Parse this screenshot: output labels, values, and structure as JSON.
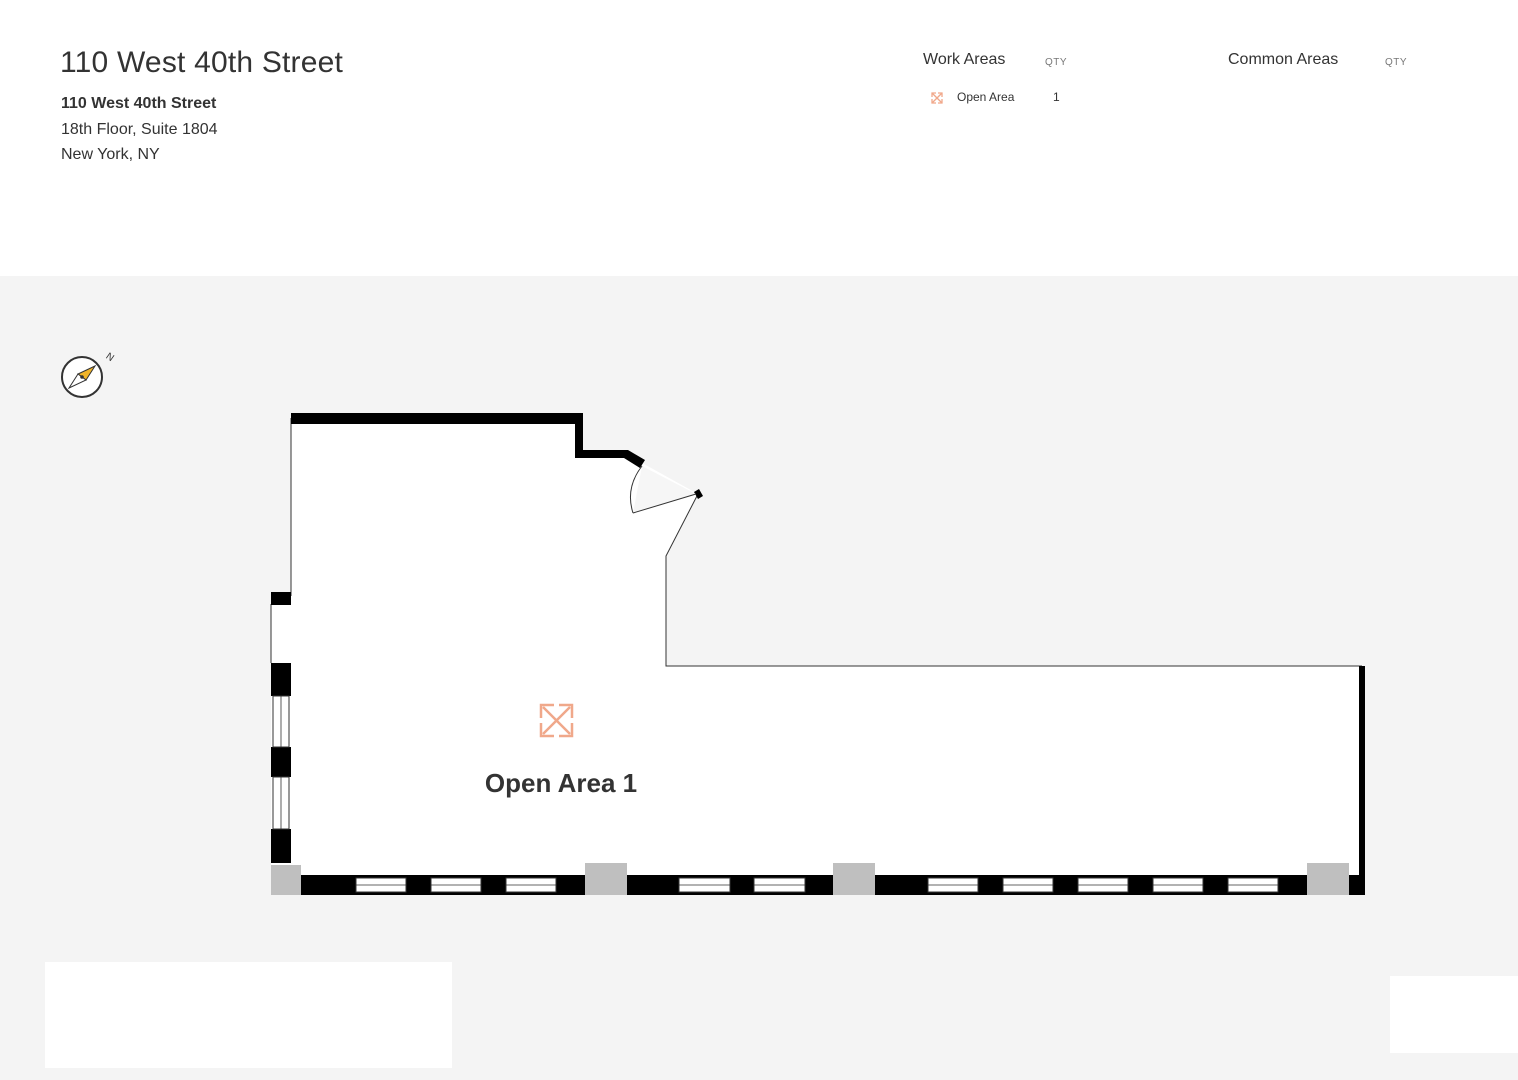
{
  "header": {
    "title": "110 West 40th Street",
    "address_line1": "110 West 40th Street",
    "address_line2": "18th Floor, Suite 1804",
    "address_line3": "New York, NY"
  },
  "legend": {
    "work_areas": {
      "heading": "Work Areas",
      "qty_label": "QTY",
      "items": [
        {
          "label": "Open Area",
          "qty": "1",
          "icon": "open-area-icon",
          "color": "#f0a88a"
        }
      ]
    },
    "common_areas": {
      "heading": "Common Areas",
      "qty_label": "QTY",
      "items": []
    }
  },
  "floorplan": {
    "compass_label": "N",
    "rooms": [
      {
        "label": "Open Area 1",
        "icon": "open-area-icon",
        "color": "#f0a88a"
      }
    ],
    "colors": {
      "background": "#f4f4f4",
      "wall": "#000000",
      "column": "#bfbfbf",
      "compass_needle": "#f0b429"
    }
  }
}
